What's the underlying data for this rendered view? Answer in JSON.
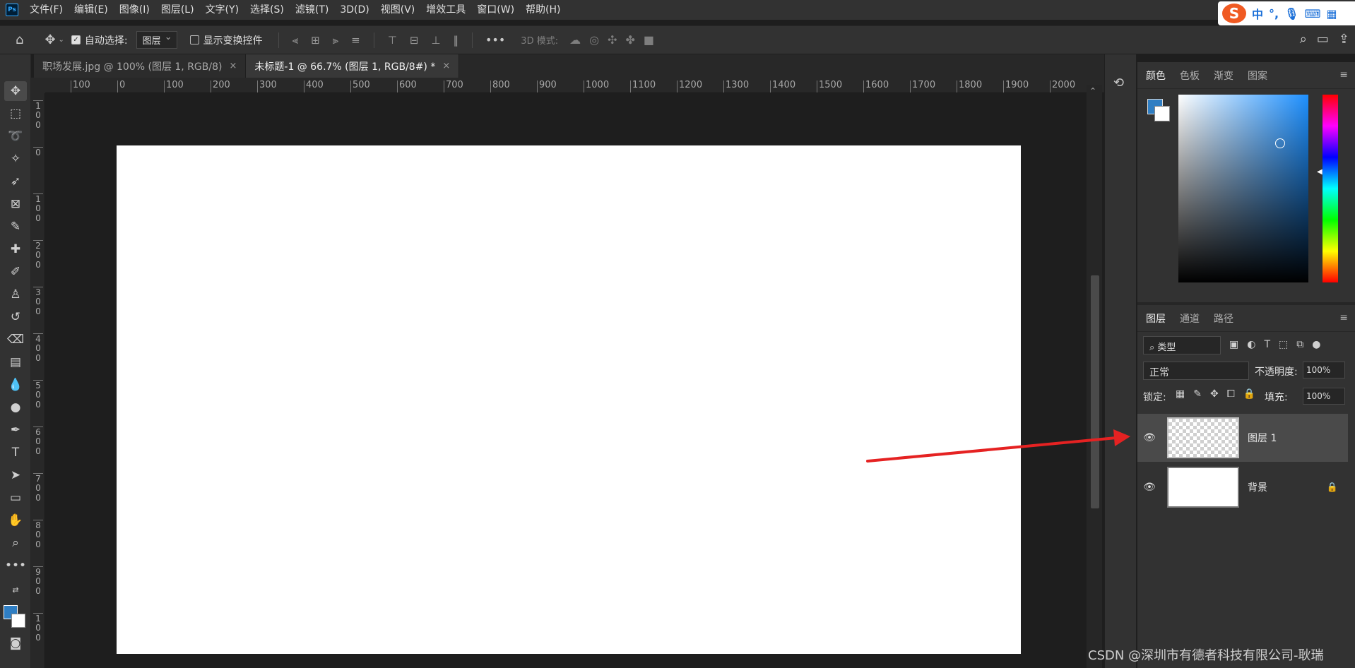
{
  "app": {
    "logo_text": "Ps"
  },
  "menu": [
    "文件(F)",
    "编辑(E)",
    "图像(I)",
    "图层(L)",
    "文字(Y)",
    "选择(S)",
    "滤镜(T)",
    "3D(D)",
    "视图(V)",
    "增效工具",
    "窗口(W)",
    "帮助(H)"
  ],
  "ime": {
    "logo": "S",
    "lang": "中",
    "punct": "°,",
    "mic": "🎙",
    "keyboard": "⌨",
    "grid": "▦"
  },
  "options": {
    "auto_select_label": "自动选择:",
    "auto_select_value": "图层",
    "transform_label": "显示变换控件",
    "mode_3d_label": "3D 模式:"
  },
  "tabs": [
    {
      "label": "职场发展.jpg @ 100% (图层 1, RGB/8)",
      "close": "×"
    },
    {
      "label": "未标题-1 @ 66.7% (图层 1, RGB/8#) *",
      "close": "×"
    }
  ],
  "ruler_top": [
    "100",
    "0",
    "100",
    "200",
    "300",
    "400",
    "500",
    "600",
    "700",
    "800",
    "900",
    "1000",
    "1100",
    "1200",
    "1300",
    "1400",
    "1500",
    "1600",
    "1700",
    "1800",
    "1900",
    "2000"
  ],
  "ruler_left": [
    "1",
    "0",
    "0",
    "0",
    "1",
    "0",
    "0",
    "2",
    "0",
    "0",
    "3",
    "0",
    "0",
    "4",
    "0",
    "0",
    "5",
    "0",
    "0",
    "6",
    "0",
    "0",
    "7",
    "0",
    "0",
    "8",
    "0",
    "0",
    "9",
    "0",
    "0",
    "1",
    "0",
    "0"
  ],
  "color_panel": {
    "tabs": [
      "颜色",
      "色板",
      "渐变",
      "图案"
    ],
    "fg_color": "#2f7ec3",
    "bg_color": "#ffffff"
  },
  "layers_panel": {
    "tabs": [
      "图层",
      "通道",
      "路径"
    ],
    "filter_label": "类型",
    "blend_mode": "正常",
    "opacity_label": "不透明度:",
    "opacity_value": "100%",
    "lock_label": "锁定:",
    "fill_label": "填充:",
    "fill_value": "100%",
    "layers": [
      {
        "name": "图层 1",
        "selected": true,
        "transparent": true
      },
      {
        "name": "背景",
        "selected": false,
        "transparent": false
      }
    ]
  },
  "watermark": "CSDN @深圳市有德者科技有限公司-耿瑞"
}
